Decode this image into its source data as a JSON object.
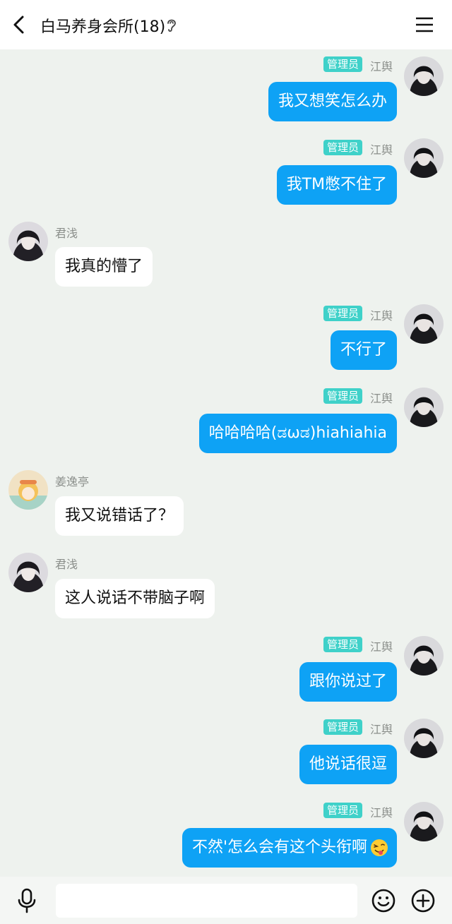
{
  "header": {
    "title": "白马养身会所(18)",
    "back_icon": "chevron-left-icon",
    "ear_icon": "ear-icon",
    "menu_icon": "hamburger-menu-icon"
  },
  "messages": [
    {
      "sender": "江舆",
      "badge": "管理员",
      "text": "我又想笑怎么办",
      "side": "self"
    },
    {
      "sender": "江舆",
      "badge": "管理员",
      "text": "我TM憋不住了",
      "side": "self"
    },
    {
      "sender": "君浅",
      "badge": "",
      "text": "我真的懵了",
      "side": "other"
    },
    {
      "sender": "江舆",
      "badge": "管理员",
      "text": "不行了",
      "side": "self"
    },
    {
      "sender": "江舆",
      "badge": "管理员",
      "text": "哈哈哈哈(ಡωಡ)hiahiahia",
      "side": "self"
    },
    {
      "sender": "姜逸亭",
      "badge": "",
      "text": "我又说错话了？",
      "side": "other"
    },
    {
      "sender": "君浅",
      "badge": "",
      "text": "这人说话不带脑子啊",
      "side": "other"
    },
    {
      "sender": "江舆",
      "badge": "管理员",
      "text": "跟你说过了",
      "side": "self"
    },
    {
      "sender": "江舆",
      "badge": "管理员",
      "text": "他说话很逗",
      "side": "self"
    },
    {
      "sender": "江舆",
      "badge": "管理员",
      "text": "不然'怎么会有这个头衔啊",
      "side": "self",
      "emoji": "tongue-wink-emoji"
    }
  ],
  "footer": {
    "mic_icon": "microphone-icon",
    "input_value": "",
    "emoji_icon": "smiley-icon",
    "plus_icon": "plus-circle-icon"
  },
  "colors": {
    "background": "#eef2ee",
    "outgoing_bubble": "#0ea2f5",
    "incoming_bubble": "#ffffff",
    "admin_badge": "#3fd1c9"
  }
}
